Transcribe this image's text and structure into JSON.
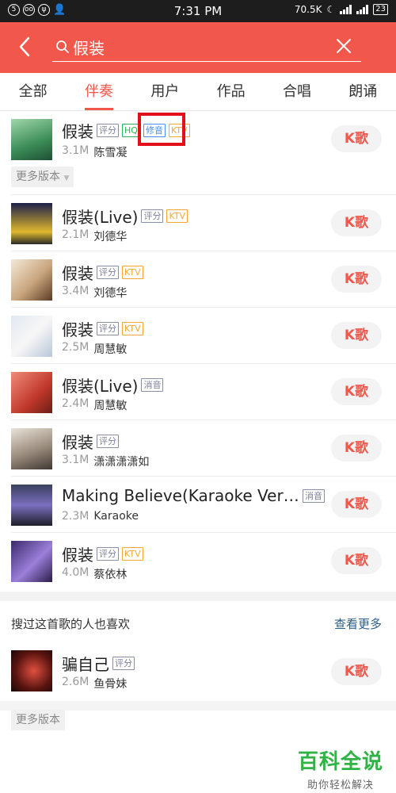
{
  "status_bar": {
    "time": "7:31 PM",
    "network_speed": "70.5K",
    "battery": "23",
    "left_icons": [
      "5",
      "oo",
      "ψ"
    ]
  },
  "header": {
    "back_icon": "back-chevron-icon",
    "search_value": "假装",
    "search_icon": "search-icon",
    "clear_icon": "close-icon",
    "accent_color": "#f1574a"
  },
  "tabs": [
    {
      "label": "全部",
      "active": false
    },
    {
      "label": "伴奏",
      "active": true
    },
    {
      "label": "用户",
      "active": false
    },
    {
      "label": "作品",
      "active": false
    },
    {
      "label": "合唱",
      "active": false
    },
    {
      "label": "朗诵",
      "active": false
    }
  ],
  "songs": [
    {
      "title": "假装",
      "tags": [
        "评分",
        "HQ",
        "修音",
        "KTV"
      ],
      "plays": "3.1M",
      "artist": "陈雪凝",
      "button": "K歌"
    },
    {
      "title": "假装(Live)",
      "tags": [
        "评分",
        "KTV"
      ],
      "plays": "2.1M",
      "artist": "刘德华",
      "button": "K歌"
    },
    {
      "title": "假装",
      "tags": [
        "评分",
        "KTV"
      ],
      "plays": "3.4M",
      "artist": "刘德华",
      "button": "K歌"
    },
    {
      "title": "假装",
      "tags": [
        "评分",
        "KTV"
      ],
      "plays": "2.5M",
      "artist": "周慧敏",
      "button": "K歌"
    },
    {
      "title": "假装(Live)",
      "tags": [
        "消音"
      ],
      "plays": "2.4M",
      "artist": "周慧敏",
      "button": "K歌"
    },
    {
      "title": "假装",
      "tags": [
        "评分"
      ],
      "plays": "3.1M",
      "artist": "潇潇潇潇如",
      "button": "K歌"
    },
    {
      "title": "Making Believe(Karaoke Versi...",
      "tags": [
        "消音"
      ],
      "plays": "2.3M",
      "artist": "Karaoke",
      "button": "K歌"
    },
    {
      "title": "假装",
      "tags": [
        "评分",
        "KTV"
      ],
      "plays": "4.0M",
      "artist": "蔡依林",
      "button": "K歌"
    }
  ],
  "more_versions": "更多版本",
  "recommend": {
    "heading": "搜过这首歌的人也喜欢",
    "see_more": "查看更多",
    "item": {
      "title": "骗自己",
      "tags": [
        "评分"
      ],
      "plays": "2.6M",
      "artist": "鱼骨妹",
      "button": "K歌"
    }
  },
  "watermark": {
    "big": "百科全说",
    "small": "助你轻松解决"
  }
}
